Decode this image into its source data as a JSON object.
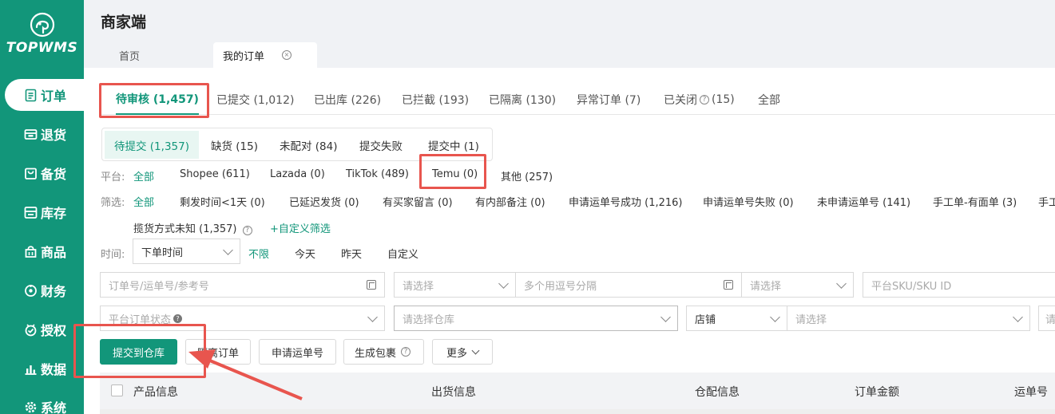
{
  "app": {
    "logo_text": "TOPWMS",
    "title": "商家端"
  },
  "sidebar": {
    "items": [
      {
        "label": "订单",
        "icon": "order-list-icon"
      },
      {
        "label": "退货",
        "icon": "return-box-icon"
      },
      {
        "label": "备货",
        "icon": "stock-bag-icon"
      },
      {
        "label": "库存",
        "icon": "inventory-icon"
      },
      {
        "label": "商品",
        "icon": "product-bag-icon"
      },
      {
        "label": "财务",
        "icon": "finance-icon"
      },
      {
        "label": "授权",
        "icon": "auth-badge-icon"
      },
      {
        "label": "数据",
        "icon": "bar-chart-icon"
      },
      {
        "label": "系统",
        "icon": "gear-icon"
      }
    ],
    "active_index": 0
  },
  "tabs": {
    "home": "首页",
    "current": "我的订单"
  },
  "status_tabs": [
    {
      "label": "待审核 (1,457)"
    },
    {
      "label": "已提交 (1,012)"
    },
    {
      "label": "已出库 (226)"
    },
    {
      "label": "已拦截 (193)"
    },
    {
      "label": "已隔离 (130)"
    },
    {
      "label": "异常订单 (7)"
    },
    {
      "label": "已关闭"
    },
    {
      "label": "(15)"
    },
    {
      "label": "全部"
    }
  ],
  "sub_tabs": [
    "待提交 (1,357)",
    "缺货 (15)",
    "未配对 (84)",
    "提交失败",
    "提交中 (1)"
  ],
  "platform": {
    "label": "平台:",
    "options": [
      "全部",
      "Shopee (611)",
      "Lazada (0)",
      "TikTok (489)",
      "Temu (0)",
      "其他 (257)"
    ]
  },
  "filter": {
    "label": "筛选:",
    "options": [
      "全部",
      "剩发时间<1天 (0)",
      "已延迟发货 (0)",
      "有买家留言 (0)",
      "有内部备注 (0)",
      "申请运单号成功 (1,216)",
      "申请运单号失败 (0)",
      "未申请运单号 (141)",
      "手工单-有面单 (3)",
      "手工"
    ],
    "row2": [
      "揽货方式未知 (1,357)",
      "+自定义筛选"
    ]
  },
  "time": {
    "label": "时间:",
    "select": "下单时间",
    "options": [
      "不限",
      "今天",
      "昨天",
      "自定义"
    ]
  },
  "search": {
    "order_placeholder": "订单号/运单号/参考号",
    "select_placeholder": "请选择",
    "multi_placeholder": "多个用逗号分隔",
    "select2_placeholder": "请选择",
    "sku_placeholder": "平台SKU/SKU ID",
    "platform_status_placeholder": "平台订单状态",
    "warehouse_placeholder": "请选择仓库",
    "store_label": "店铺",
    "store_placeholder": "请选择",
    "last_placeholder": "请"
  },
  "actions": {
    "submit": "提交到仓库",
    "isolate": "隔离订单",
    "apply": "申请运单号",
    "package": "生成包裹",
    "more": "更多"
  },
  "table": {
    "headers": [
      "产品信息",
      "出货信息",
      "仓配信息",
      "订单金额",
      "运单号"
    ]
  },
  "colors": {
    "brand": "#12967a",
    "annotation": "#e8554e"
  }
}
